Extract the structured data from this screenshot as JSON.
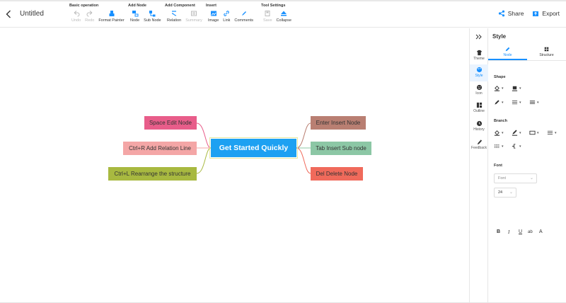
{
  "header": {
    "title": "Untitled",
    "share_label": "Share",
    "export_label": "Export"
  },
  "toolbar": {
    "basic": {
      "title": "Basic operation",
      "undo": "Undo",
      "redo": "Redo",
      "format_painter": "Format Painter"
    },
    "add_node": {
      "title": "Add Node",
      "node": "Node",
      "sub_node": "Sub Node"
    },
    "add_component": {
      "title": "Add Component",
      "relation": "Relation",
      "summary": "Summary"
    },
    "insert": {
      "title": "Insert",
      "image": "Image",
      "link": "Link",
      "comments": "Comments"
    },
    "tool_settings": {
      "title": "Tool Settings",
      "save": "Save",
      "collapse": "Collapse"
    }
  },
  "mindmap": {
    "root": "Get Started Quickly",
    "left": [
      "Space Edit Node",
      "Ctrl+R Add Relation Line",
      "Ctrl+L Rearrange the structure"
    ],
    "right": [
      "Enter Insert Node",
      "Tab Insert Sub node",
      "Del Delete Node"
    ]
  },
  "rail": {
    "theme": "Theme",
    "style": "Style",
    "icon": "Icon",
    "outline": "Outline",
    "history": "History",
    "feedback": "Feedback"
  },
  "panel": {
    "title": "Style",
    "tab_node": "Node",
    "tab_structure": "Structure",
    "shape_title": "Shape",
    "branch_title": "Branch",
    "font_title": "Font",
    "font_family_placeholder": "Font",
    "font_size": "24",
    "format": {
      "bold": "B",
      "italic": "I",
      "underline": "U",
      "strike": "ab",
      "color": "A"
    }
  },
  "colors": {
    "root": "#1da1f2",
    "accent": "#1890ff"
  }
}
